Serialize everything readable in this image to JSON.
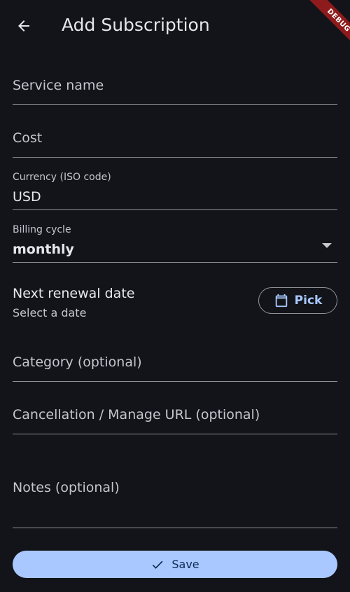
{
  "app": {
    "title": "Add Subscription",
    "debug_label": "DEBUG"
  },
  "form": {
    "service_name": {
      "placeholder": "Service name",
      "value": ""
    },
    "cost": {
      "placeholder": "Cost",
      "value": ""
    },
    "currency": {
      "label": "Currency (ISO code)",
      "value": "USD"
    },
    "billing_cycle": {
      "label": "Billing cycle",
      "value": "monthly"
    },
    "renewal": {
      "label": "Next renewal date",
      "value": "Select a date",
      "button_label": "Pick"
    },
    "category": {
      "placeholder": "Category (optional)",
      "value": ""
    },
    "cancel_url": {
      "placeholder": "Cancellation / Manage URL (optional)",
      "value": ""
    },
    "notes": {
      "placeholder": "Notes (optional)",
      "value": ""
    }
  },
  "actions": {
    "save_label": "Save"
  },
  "icons": {
    "back": "arrow-left-icon",
    "calendar": "calendar-icon",
    "check": "check-icon",
    "dropdown": "dropdown-arrow-icon"
  },
  "colors": {
    "background": "#121419",
    "primary": "#a8c8ff",
    "on_primary": "#0d2b54",
    "debug_banner": "#8e1b1b"
  }
}
